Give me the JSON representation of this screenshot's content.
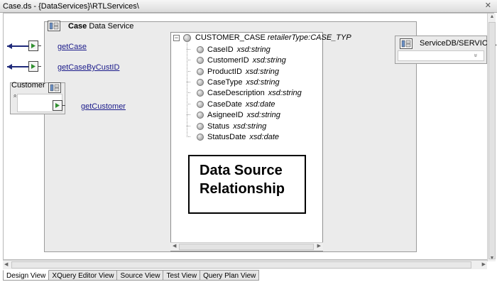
{
  "window": {
    "title": "Case.ds - {DataServices}\\RTLServices\\",
    "close_glyph": "✕"
  },
  "service": {
    "name": "Case",
    "type_label": "Data Service"
  },
  "operations": [
    {
      "label": "getCase"
    },
    {
      "label": "getCaseByCustID"
    },
    {
      "label": "getCustomer"
    }
  ],
  "customer": {
    "label": "Customer",
    "collapse_glyph": "»"
  },
  "schema": {
    "root": {
      "name": "CUSTOMER_CASE",
      "annotation": "retailerType:CASE_TYP",
      "toggle": "−"
    },
    "fields": [
      {
        "name": "CaseID",
        "type": "xsd:string"
      },
      {
        "name": "CustomerID",
        "type": "xsd:string"
      },
      {
        "name": "ProductID",
        "type": "xsd:string"
      },
      {
        "name": "CaseType",
        "type": "xsd:string"
      },
      {
        "name": "CaseDescription",
        "type": "xsd:string"
      },
      {
        "name": "CaseDate",
        "type": "xsd:date"
      },
      {
        "name": "AsigneeID",
        "type": "xsd:string"
      },
      {
        "name": "Status",
        "type": "xsd:string"
      },
      {
        "name": "StatusDate",
        "type": "xsd:date"
      }
    ]
  },
  "callout": {
    "line1": "Data Source",
    "line2": "Relationship"
  },
  "servicedb": {
    "label": "ServiceDB/SERVICE...",
    "chevron": "»"
  },
  "tabs": [
    {
      "label": "Design View",
      "active": true
    },
    {
      "label": "XQuery Editor View",
      "active": false
    },
    {
      "label": "Source View",
      "active": false
    },
    {
      "label": "Test View",
      "active": false
    },
    {
      "label": "Query Plan View",
      "active": false
    }
  ],
  "colors": {
    "link": "#1a1a8a",
    "arrow": "#1f2a7a",
    "panel_bg": "#ebebeb"
  }
}
